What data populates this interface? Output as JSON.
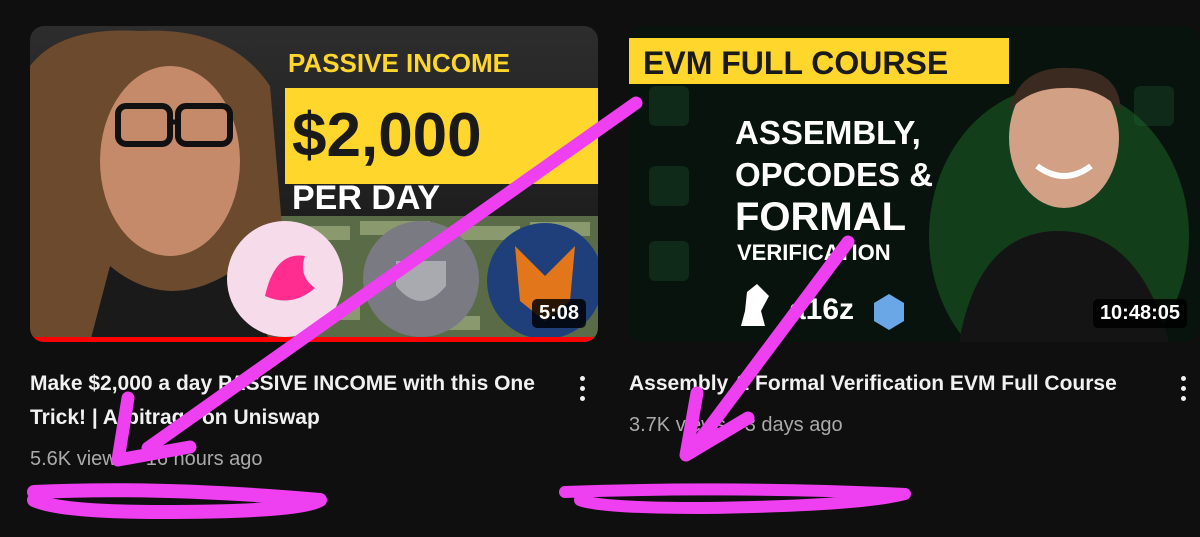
{
  "videos": [
    {
      "thumbnail": {
        "banner_top": "PASSIVE INCOME",
        "banner_amount": "$2,000",
        "banner_bottom": "PER DAY",
        "icons": [
          "unicorn-icon",
          "shield-logo-icon",
          "fox-icon"
        ]
      },
      "duration": "5:08",
      "watched_fraction": 1.0,
      "title": "Make $2,000 a day PASSIVE INCOME with this One Trick! | Arbitrage on Uniswap",
      "views": "5.6K views",
      "age": "16 hours ago"
    },
    {
      "thumbnail": {
        "banner_top": "EVM FULL COURSE",
        "line1": "ASSEMBLY,",
        "line2": "OPCODES &",
        "line3": "FORMAL",
        "line4": "VERIFICATION",
        "brand": "a16z"
      },
      "duration": "10:48:05",
      "title": "Assembly & Formal Verification EVM Full Course",
      "views": "3.7K views",
      "age": "3 days ago"
    }
  ],
  "separator": "•",
  "colors": {
    "annotation": "#ee3ff0",
    "progress": "#ff0000",
    "banner_yellow": "#ffd62b",
    "accent_green": "#3fe05a"
  }
}
